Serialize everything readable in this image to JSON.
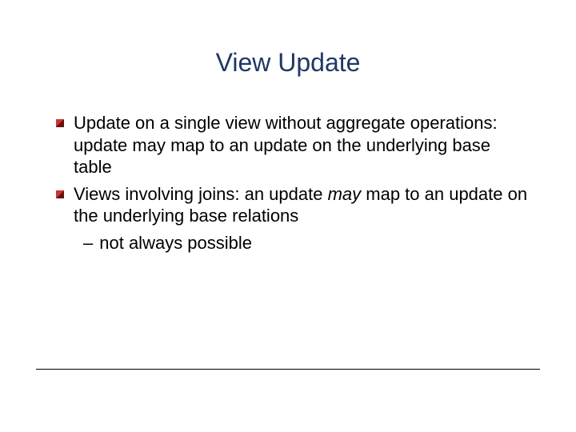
{
  "title": "View Update",
  "bullets": [
    {
      "text": "Update on a single view without aggregate operations: update may map to an update on the underlying base table"
    },
    {
      "prefix": "Views involving joins: an update ",
      "italic": "may",
      "suffix": " map to an update on the underlying base relations",
      "sub": "not always possible"
    }
  ],
  "dash": "–"
}
